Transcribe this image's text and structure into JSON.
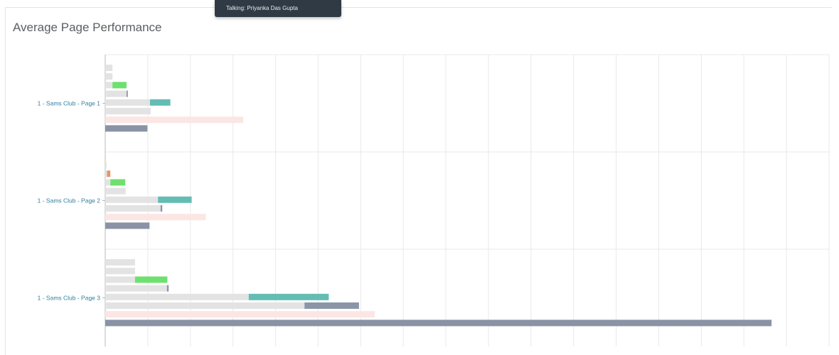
{
  "page": {
    "title": "Average Page Performance",
    "tooltip": "Talking: Priyanka Das Gupta"
  },
  "colors": {
    "grid": "#e9e9e9",
    "axis": "#b8b8b8",
    "label": "#2f7fa0",
    "light": "#e3e3e3",
    "green": "#6ee06e",
    "teal": "#63bdb3",
    "slate": "#8a96a8",
    "pink": "#fbe6e4",
    "orange": "#e89566",
    "darkslate": "#8993a5"
  },
  "chart_data": {
    "type": "bar",
    "orientation": "horizontal",
    "stacked": true,
    "title": "Average Page Performance",
    "categories": [
      "1 - Sams Club - Page 1",
      "1 - Sams Club - Page 2",
      "1 - Sams Club - Page 3"
    ],
    "xlim": [
      0,
      17
    ],
    "x_gridlines": 17,
    "grid": true,
    "rows_per_category": [
      [
        [
          {
            "value": 0.17,
            "color": "light"
          }
        ],
        [
          {
            "value": 0.17,
            "color": "light"
          }
        ],
        [
          {
            "value": 0.17,
            "color": "light"
          },
          {
            "value": 0.33,
            "color": "green"
          }
        ],
        [
          {
            "value": 0.5,
            "color": "light"
          },
          {
            "value": 0.03,
            "color": "slate"
          }
        ],
        [
          {
            "value": 1.05,
            "color": "light"
          },
          {
            "value": 0.48,
            "color": "teal"
          }
        ],
        [
          {
            "value": 1.07,
            "color": "light"
          }
        ],
        [
          {
            "value": 3.24,
            "color": "pink"
          }
        ],
        [
          {
            "value": 0.99,
            "color": "darkslate"
          }
        ]
      ],
      [
        [
          {
            "value": 0.03,
            "color": "light"
          }
        ],
        [
          {
            "value": 0.04,
            "color": "light"
          },
          {
            "value": 0.08,
            "color": "orange"
          }
        ],
        [
          {
            "value": 0.12,
            "color": "light"
          },
          {
            "value": 0.35,
            "color": "green"
          }
        ],
        [
          {
            "value": 0.48,
            "color": "light"
          }
        ],
        [
          {
            "value": 1.24,
            "color": "light"
          },
          {
            "value": 0.79,
            "color": "teal"
          }
        ],
        [
          {
            "value": 1.3,
            "color": "light"
          },
          {
            "value": 0.04,
            "color": "slate"
          }
        ],
        [
          {
            "value": 2.36,
            "color": "pink"
          }
        ],
        [
          {
            "value": 1.04,
            "color": "darkslate"
          }
        ]
      ],
      [
        [
          {
            "value": 0.7,
            "color": "light"
          }
        ],
        [
          {
            "value": 0.7,
            "color": "light"
          }
        ],
        [
          {
            "value": 0.7,
            "color": "light"
          },
          {
            "value": 0.76,
            "color": "green"
          }
        ],
        [
          {
            "value": 1.45,
            "color": "light"
          },
          {
            "value": 0.04,
            "color": "slate"
          }
        ],
        [
          {
            "value": 3.37,
            "color": "light"
          },
          {
            "value": 1.88,
            "color": "teal"
          }
        ],
        [
          {
            "value": 4.68,
            "color": "light"
          },
          {
            "value": 1.28,
            "color": "slate"
          }
        ],
        [
          {
            "value": 6.33,
            "color": "pink"
          }
        ],
        [
          {
            "value": 15.65,
            "color": "darkslate"
          }
        ]
      ]
    ]
  }
}
